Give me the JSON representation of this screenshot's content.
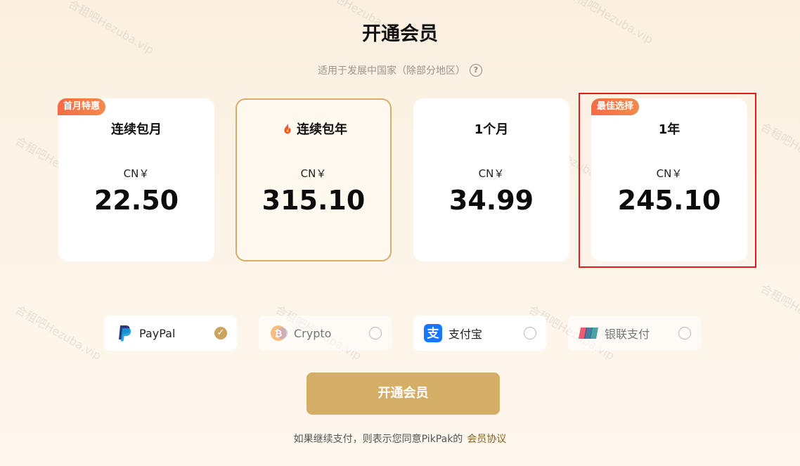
{
  "header": {
    "title": "开通会员",
    "subtitle": "适用于发展中国家（除部分地区）",
    "help_icon": "?"
  },
  "plans": [
    {
      "badge": "首月特惠",
      "name": "连续包月",
      "currency": "CN￥",
      "price": "22.50",
      "selected": false
    },
    {
      "badge": "",
      "name": "连续包年",
      "icon": "fire-icon",
      "currency": "CN￥",
      "price": "315.10",
      "selected": true
    },
    {
      "badge": "",
      "name": "1个月",
      "currency": "CN￥",
      "price": "34.99",
      "selected": false
    },
    {
      "badge": "最佳选择",
      "name": "1年",
      "currency": "CN￥",
      "price": "245.10",
      "selected": false,
      "highlighted": true
    }
  ],
  "payment_methods": [
    {
      "label": "PayPal",
      "icon": "paypal-icon",
      "checked": true
    },
    {
      "label": "Crypto",
      "icon": "bitcoin-icon",
      "checked": false
    },
    {
      "label": "支付宝",
      "icon": "alipay-icon",
      "checked": false
    },
    {
      "label": "银联支付",
      "icon": "unionpay-icon",
      "checked": false
    }
  ],
  "cta": {
    "label": "开通会员"
  },
  "agreement": {
    "text": "如果继续支付，则表示您同意PikPak的",
    "link": "会员协议"
  },
  "watermark": "合租吧Hezuba.vip",
  "colors": {
    "accent": "#d4ad66",
    "badge": "#f76b45",
    "highlight_border": "#e21b1b"
  }
}
